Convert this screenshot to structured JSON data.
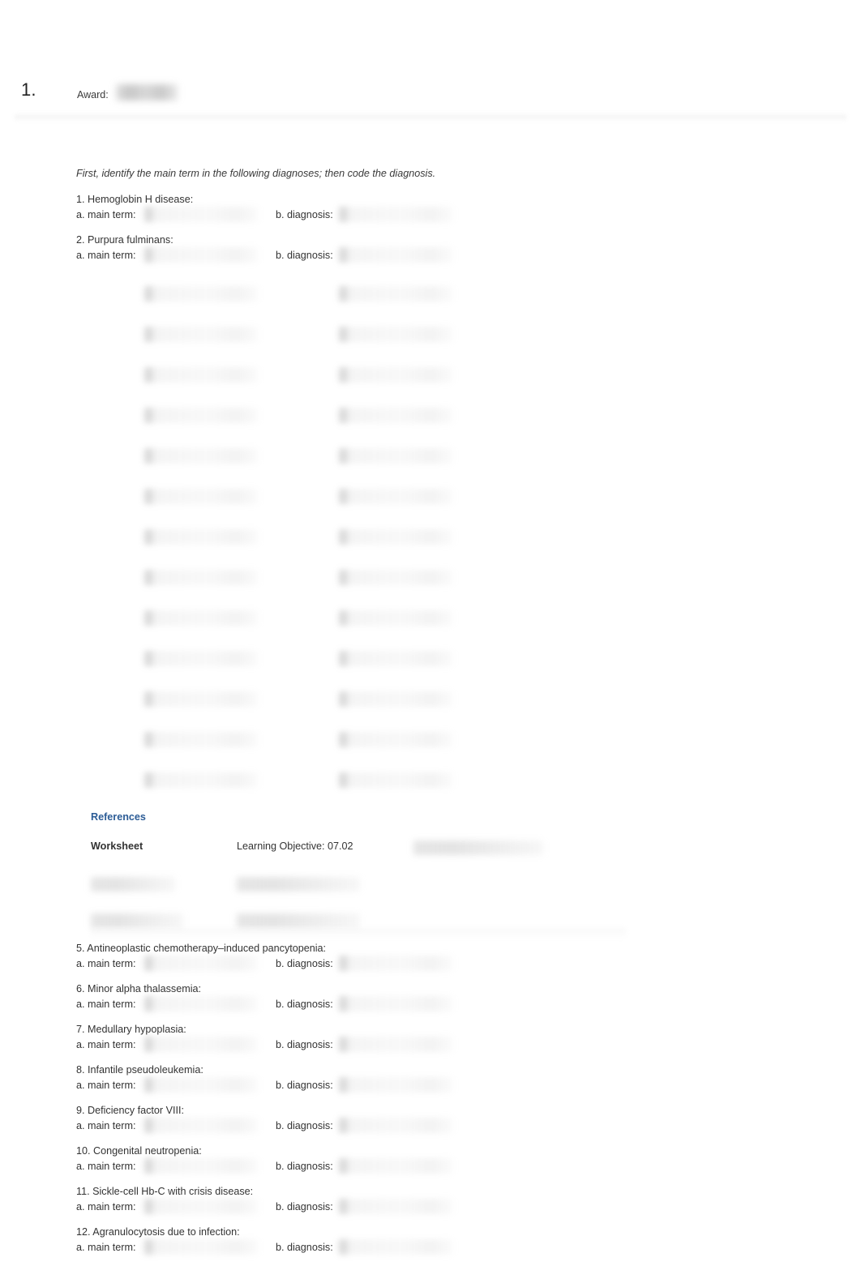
{
  "question": {
    "number": "1.",
    "award_label": "Award:",
    "award_value_redacted": ""
  },
  "instruction": "First, identify the main term in the following diagnoses; then code the diagnosis.",
  "labels": {
    "main_term": "a. main term:",
    "diagnosis": "b. diagnosis:"
  },
  "questions_top": [
    {
      "title": "1. Hemoglobin H disease:",
      "main_term_value": "",
      "diagnosis_value": ""
    },
    {
      "title": "2. Purpura fulminans:",
      "main_term_value": "",
      "diagnosis_value": ""
    }
  ],
  "blurred_field_rows": [
    {
      "main_term_value": "",
      "diagnosis_value": ""
    },
    {
      "main_term_value": "",
      "diagnosis_value": ""
    },
    {
      "main_term_value": "",
      "diagnosis_value": ""
    },
    {
      "main_term_value": "",
      "diagnosis_value": ""
    },
    {
      "main_term_value": "",
      "diagnosis_value": ""
    },
    {
      "main_term_value": "",
      "diagnosis_value": ""
    },
    {
      "main_term_value": "",
      "diagnosis_value": ""
    },
    {
      "main_term_value": "",
      "diagnosis_value": ""
    },
    {
      "main_term_value": "",
      "diagnosis_value": ""
    },
    {
      "main_term_value": "",
      "diagnosis_value": ""
    },
    {
      "main_term_value": "",
      "diagnosis_value": ""
    },
    {
      "main_term_value": "",
      "diagnosis_value": ""
    },
    {
      "main_term_value": "",
      "diagnosis_value": ""
    }
  ],
  "references": {
    "title": "References",
    "rows": [
      {
        "col1": "Worksheet",
        "col2": "Learning Objective: 07.02",
        "col3": "",
        "col1_blurred": false,
        "col2_blurred": false,
        "col3_blurred": true
      },
      {
        "col1": "",
        "col2": "",
        "col3": "",
        "col1_blurred": true,
        "col2_blurred": true,
        "col3_blurred": false
      },
      {
        "col1": "",
        "col2": "",
        "col3": "",
        "col1_blurred": true,
        "col2_blurred": true,
        "col3_blurred": false
      }
    ]
  },
  "questions_bottom": [
    {
      "title": "5. Antineoplastic chemotherapy–induced pancytopenia:",
      "main_term_value": "",
      "diagnosis_value": ""
    },
    {
      "title": "6. Minor alpha thalassemia:",
      "main_term_value": "",
      "diagnosis_value": ""
    },
    {
      "title": "7. Medullary hypoplasia:",
      "main_term_value": "",
      "diagnosis_value": ""
    },
    {
      "title": "8. Infantile pseudoleukemia:",
      "main_term_value": "",
      "diagnosis_value": ""
    },
    {
      "title": "9. Deficiency factor VIII:",
      "main_term_value": "",
      "diagnosis_value": ""
    },
    {
      "title": "10. Congenital neutropenia:",
      "main_term_value": "",
      "diagnosis_value": ""
    },
    {
      "title": "11. Sickle-cell Hb-C with crisis disease:",
      "main_term_value": "",
      "diagnosis_value": ""
    },
    {
      "title": "12. Agranulocytosis due to infection:",
      "main_term_value": "",
      "diagnosis_value": ""
    }
  ],
  "colors": {
    "reference_link": "#2c5c96",
    "text": "#333333",
    "page_background": "#ffffff"
  }
}
